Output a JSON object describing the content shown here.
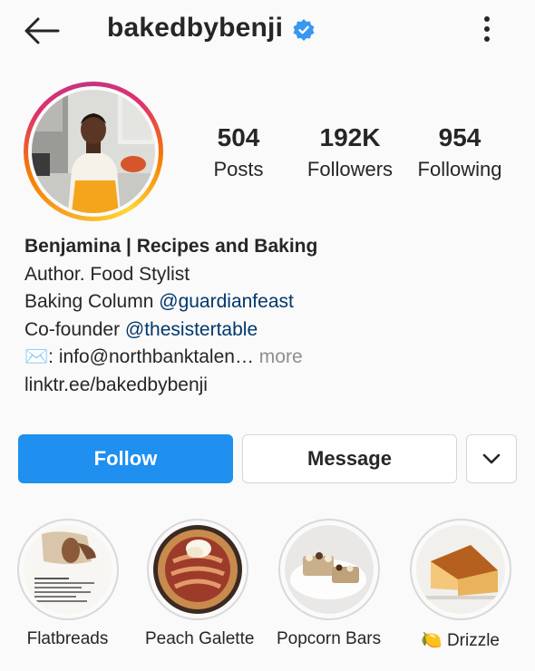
{
  "header": {
    "username": "bakedbybenji",
    "verified": true
  },
  "stats": [
    {
      "value": "504",
      "label": "Posts"
    },
    {
      "value": "192K",
      "label": "Followers"
    },
    {
      "value": "954",
      "label": "Following"
    }
  ],
  "bio": {
    "name": "Benjamina | Recipes and Baking",
    "line1": "Author. Food Stylist",
    "line2_prefix": "Baking Column ",
    "line2_mention": "@guardianfeast",
    "line3_prefix": "Co-founder ",
    "line3_mention": "@thesistertable",
    "line4_emoji": "✉️",
    "line4_text": ": info@northbanktalen…",
    "line4_more": " more",
    "website": "linktr.ee/bakedbybenji"
  },
  "actions": {
    "follow": "Follow",
    "message": "Message"
  },
  "highlights": [
    {
      "label": "Flatbreads"
    },
    {
      "label": "Peach Galette"
    },
    {
      "label": "Popcorn Bars"
    },
    {
      "emoji": "🍋",
      "label": "Drizzle"
    }
  ],
  "colors": {
    "accent": "#1f8ff0",
    "verified": "#3897f0",
    "link": "#00376b"
  }
}
